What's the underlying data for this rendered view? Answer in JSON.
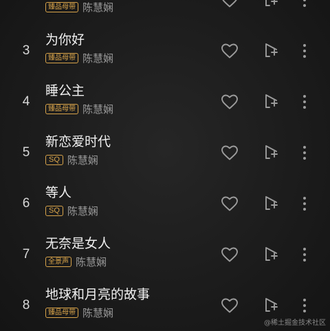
{
  "songs": [
    {
      "index": "",
      "title": "",
      "badge": "臻品母带",
      "badge_type": "gold",
      "artist": "陈慧娴"
    },
    {
      "index": "3",
      "title": "为你好",
      "badge": "臻品母带",
      "badge_type": "gold",
      "artist": "陈慧娴"
    },
    {
      "index": "4",
      "title": "睡公主",
      "badge": "臻品母带",
      "badge_type": "gold",
      "artist": "陈慧娴"
    },
    {
      "index": "5",
      "title": "新恋爱时代",
      "badge": "SQ",
      "badge_type": "sq",
      "artist": "陈慧娴"
    },
    {
      "index": "6",
      "title": "等人",
      "badge": "SQ",
      "badge_type": "sq",
      "artist": "陈慧娴"
    },
    {
      "index": "7",
      "title": "无奈是女人",
      "badge": "全景声",
      "badge_type": "gold",
      "artist": "陈慧娴"
    },
    {
      "index": "8",
      "title": "地球和月亮的故事",
      "badge": "臻品母带",
      "badge_type": "gold",
      "artist": "陈慧娴"
    }
  ],
  "icons": {
    "like": "heart-outline-icon",
    "add_to_playlist": "add-to-playlist-icon",
    "more": "more-vertical-icon"
  },
  "colors": {
    "badge": "#d9a44a",
    "icon": "#9c9c9c",
    "title": "#f0f0f0",
    "artist": "#9a9a9a"
  },
  "watermark": "@稀土掘金技术社区"
}
